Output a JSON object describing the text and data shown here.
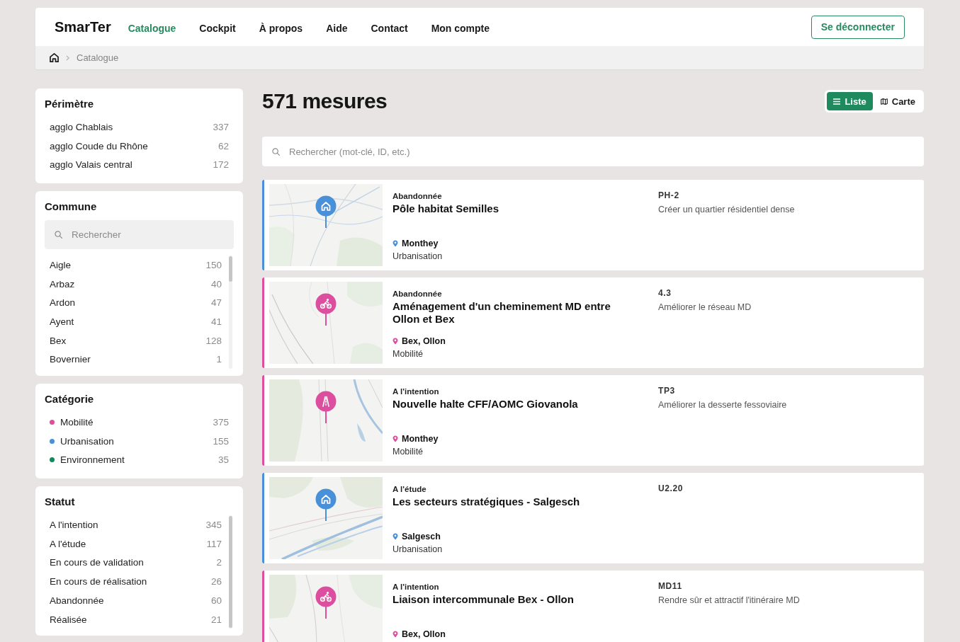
{
  "header": {
    "logo": "SmarTer",
    "nav": [
      {
        "label": "Catalogue",
        "selected": true
      },
      {
        "label": "Cockpit",
        "selected": false
      },
      {
        "label": "À propos",
        "selected": false
      },
      {
        "label": "Aide",
        "selected": false
      },
      {
        "label": "Contact",
        "selected": false
      },
      {
        "label": "Mon compte",
        "selected": false
      }
    ],
    "logout_button": "Se déconnecter"
  },
  "breadcrumb": {
    "items": [
      "Catalogue"
    ]
  },
  "filters": [
    {
      "title": "Périmètre",
      "kind": "list",
      "items": [
        {
          "label": "agglo Chablais",
          "count": "337"
        },
        {
          "label": "agglo Coude du Rhône",
          "count": "62"
        },
        {
          "label": "agglo Valais central",
          "count": "172"
        }
      ]
    },
    {
      "title": "Commune",
      "kind": "scroll_list",
      "search": {
        "placeholder": "Rechercher"
      },
      "items": [
        {
          "label": "Aigle",
          "count": "150"
        },
        {
          "label": "Arbaz",
          "count": "40"
        },
        {
          "label": "Ardon",
          "count": "47"
        },
        {
          "label": "Ayent",
          "count": "41"
        },
        {
          "label": "Bex",
          "count": "128"
        },
        {
          "label": "Bovernier",
          "count": "1"
        }
      ]
    },
    {
      "title": "Catégorie",
      "kind": "list",
      "items": [
        {
          "label": "Mobilité",
          "count": "375",
          "color": "#dc4f9f"
        },
        {
          "label": "Urbanisation",
          "count": "155",
          "color": "#4a90d9"
        },
        {
          "label": "Environnement",
          "count": "35",
          "color": "#15875a"
        }
      ]
    },
    {
      "title": "Statut",
      "kind": "scroll_list",
      "items": [
        {
          "label": "A l'intention",
          "count": "345"
        },
        {
          "label": "A l'étude",
          "count": "117"
        },
        {
          "label": "En cours de validation",
          "count": "2"
        },
        {
          "label": "En cours de réalisation",
          "count": "26"
        },
        {
          "label": "Abandonnée",
          "count": "60"
        },
        {
          "label": "Réalisée",
          "count": "21"
        }
      ]
    }
  ],
  "main": {
    "title": "571 mesures",
    "views": [
      {
        "label": "Liste",
        "kind": "list",
        "selected": true
      },
      {
        "label": "Carte",
        "kind": "map",
        "selected": false
      }
    ],
    "search": {
      "placeholder": "Rechercher (mot-clé, ID, etc.)"
    },
    "results": [
      {
        "status": "Abandonnée",
        "title": "Pôle habitat Semilles",
        "location": "Monthey",
        "category": "Urbanisation",
        "color": "#4a90d9",
        "marker": {
          "kind": "house"
        },
        "code": "PH-2",
        "description": "Créer un quartier résidentiel dense"
      },
      {
        "status": "Abandonnée",
        "title": "Aménagement d'un cheminement MD entre Ollon et Bex",
        "location": "Bex, Ollon",
        "category": "Mobilité",
        "color": "#dc4f9f",
        "marker": {
          "kind": "bicycle"
        },
        "code": "4.3",
        "description": "Améliorer le réseau MD"
      },
      {
        "status": "A l'intention",
        "title": "Nouvelle halte CFF/AOMC Giovanola",
        "location": "Monthey",
        "category": "Mobilité",
        "color": "#dc4f9f",
        "marker": {
          "kind": "road"
        },
        "code": "TP3",
        "description": "Améliorer la desserte fessoviaire"
      },
      {
        "status": "A l'étude",
        "title": "Les secteurs stratégiques - Salgesch",
        "location": "Salgesch",
        "category": "Urbanisation",
        "color": "#4a90d9",
        "marker": {
          "kind": "house"
        },
        "code": "U2.20"
      },
      {
        "status": "A l'intention",
        "title": "Liaison intercommunale Bex - Ollon",
        "location": "Bex, Ollon",
        "color": "#dc4f9f",
        "marker": {
          "kind": "bicycle"
        },
        "code": "MD11",
        "description": "Rendre sûr et attractif l'itinéraire MD"
      }
    ]
  }
}
